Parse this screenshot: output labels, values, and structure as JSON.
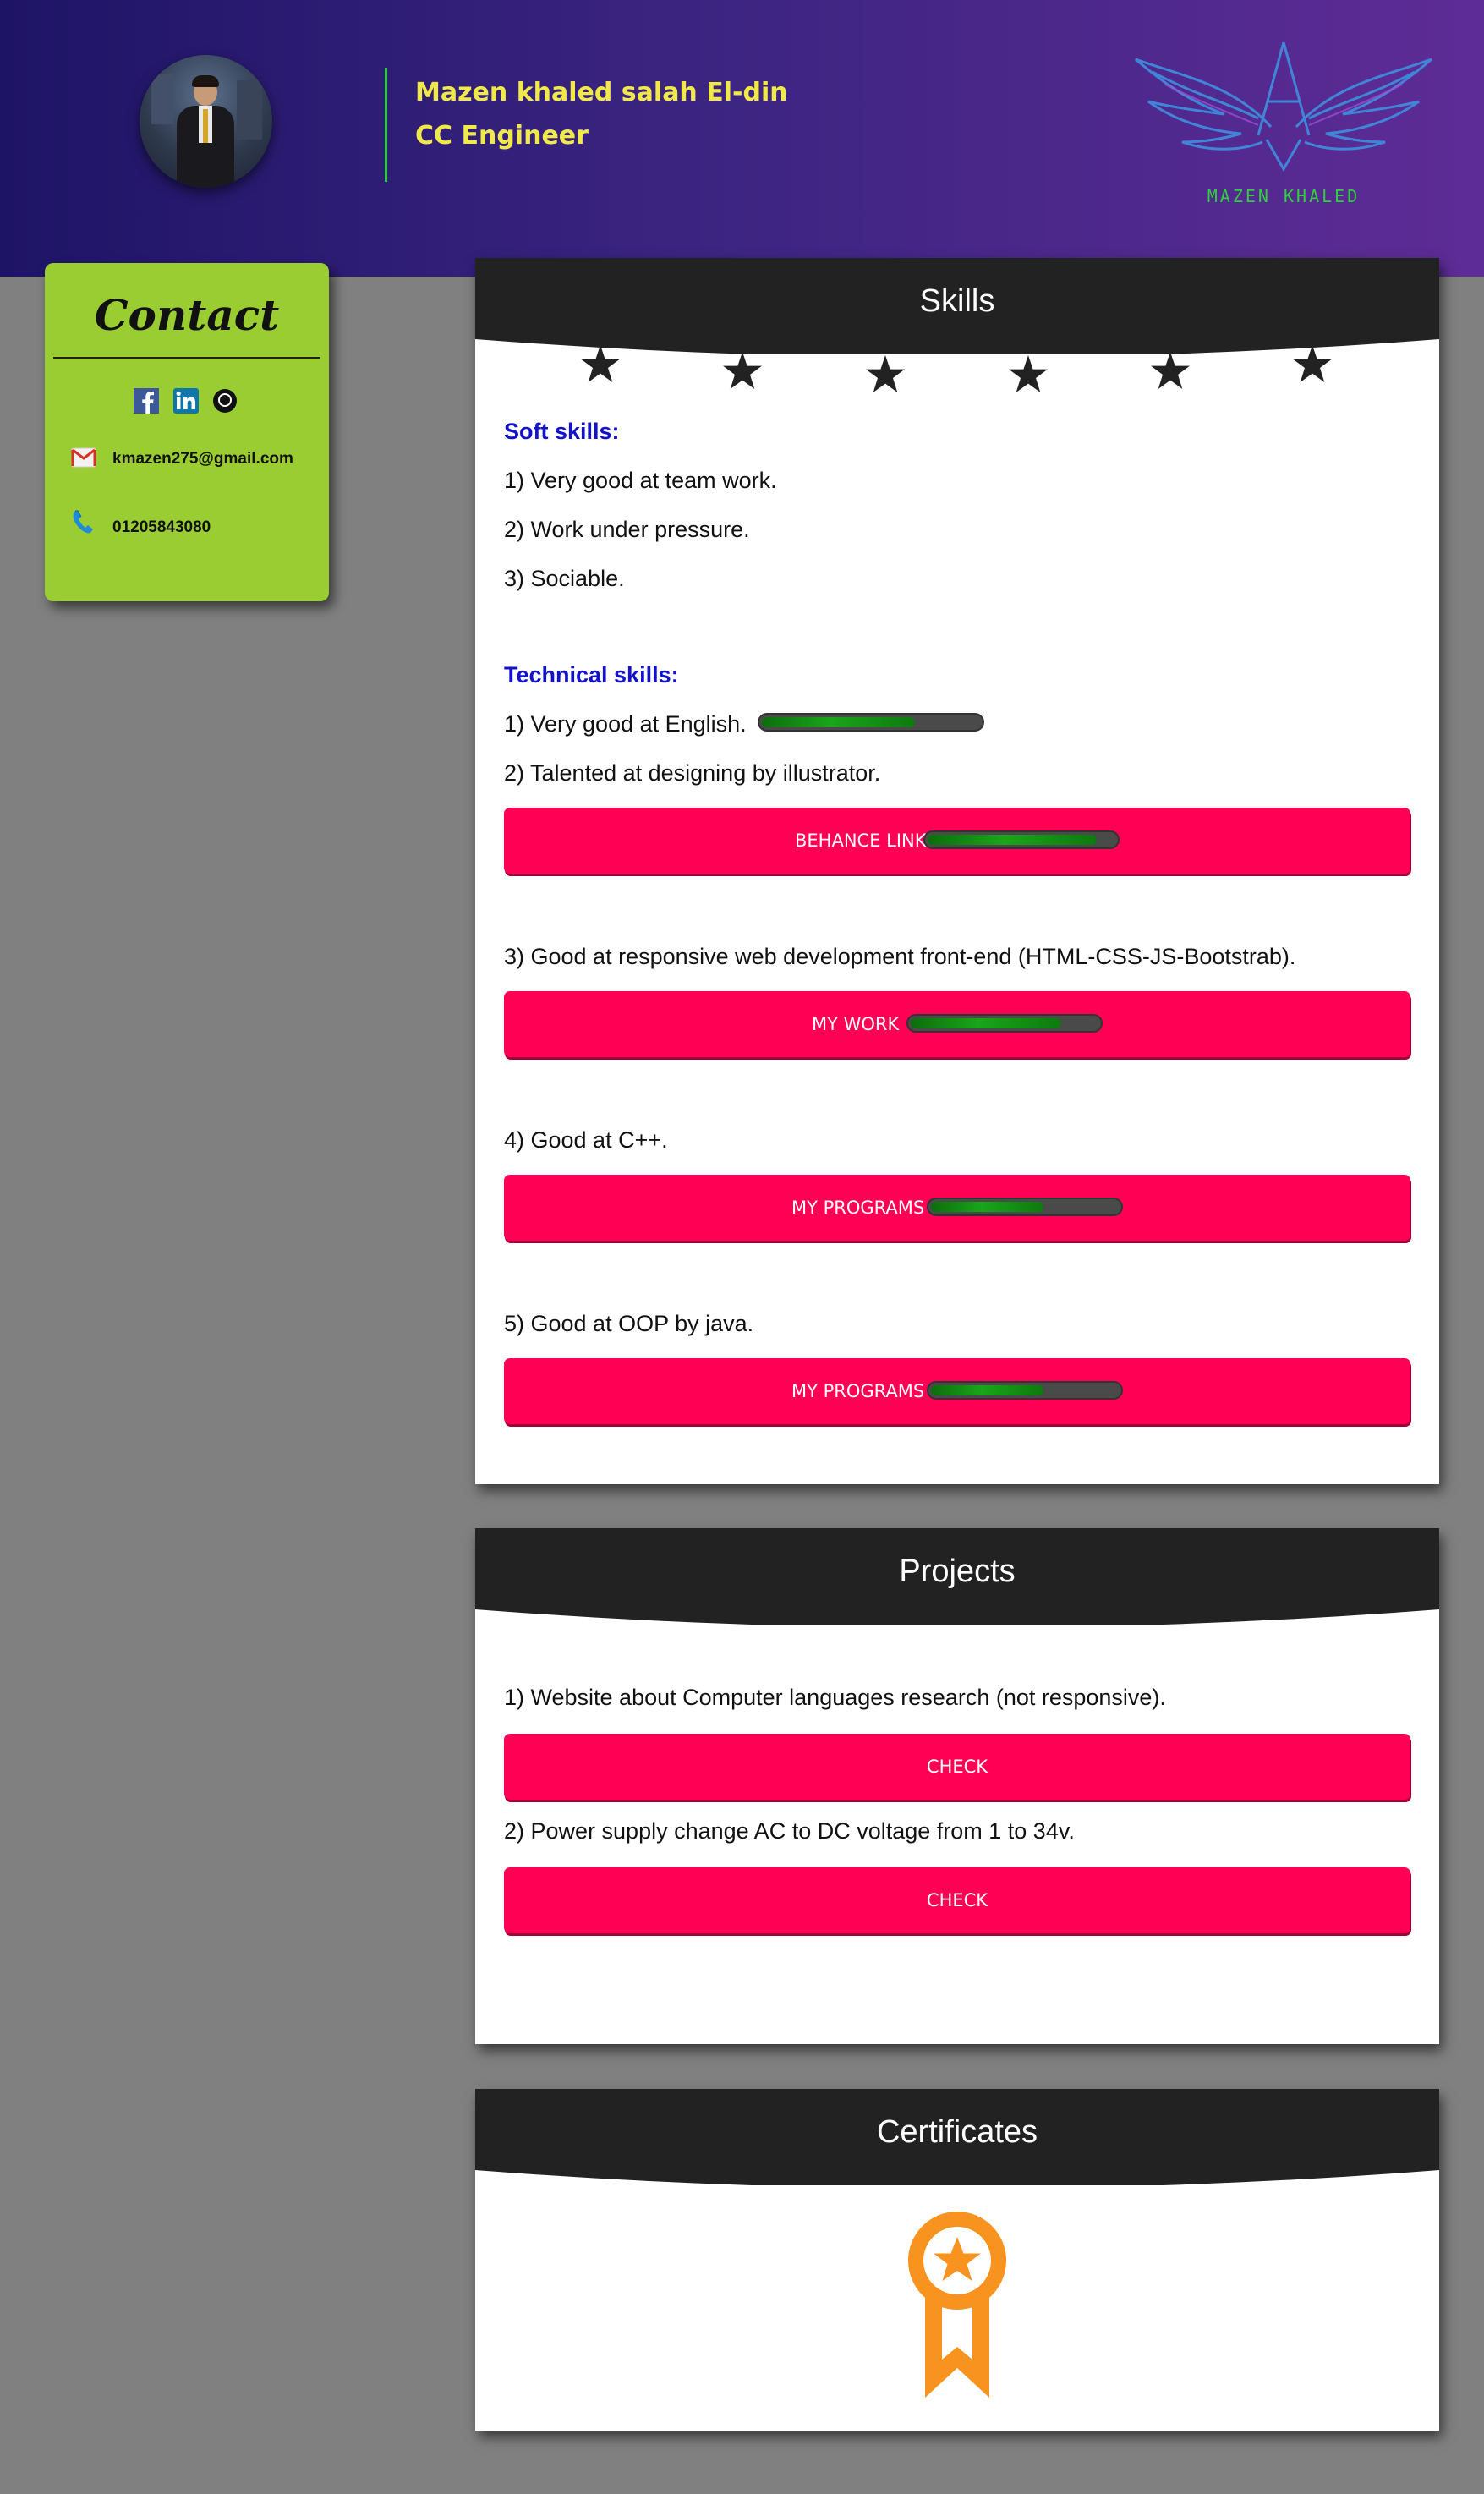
{
  "header": {
    "name": "Mazen khaled salah El-din",
    "role": "CC Engineer",
    "logo_text": "MAZEN KHALED",
    "accent_color": "#f1e94a",
    "divider_color": "#27d32e"
  },
  "contact": {
    "title": "Contact",
    "social_icons": [
      "facebook-icon",
      "linkedin-icon",
      "github-icon"
    ],
    "email": "kmazen275@gmail.com",
    "phone": "01205843080",
    "background": "#9acd32"
  },
  "skills": {
    "title": "Skills",
    "soft_heading": "Soft skills:",
    "soft": [
      "1) Very good at team work.",
      "2) Work under pressure.",
      "3) Sociable."
    ],
    "tech_heading": "Technical skills:",
    "tech": [
      {
        "text": "1) Very good at English.",
        "level": 0.7
      },
      {
        "text": "2) Talented at designing by illustrator.",
        "button": "BEHANCE LINK",
        "level": 0.9
      },
      {
        "text": "3) Good at responsive web development front-end (HTML-CSS-JS-Bootstrab).",
        "button": "MY WORK",
        "level": 0.8
      },
      {
        "text": "4) Good at C++.",
        "button": "MY PROGRAMS",
        "level": 0.6
      },
      {
        "text": "5) Good at OOP by java.",
        "button": "MY PROGRAMS",
        "level": 0.6
      }
    ]
  },
  "projects": {
    "title": "Projects",
    "items": [
      {
        "text": "1) Website about Computer languages research (not responsive).",
        "button": "CHECK"
      },
      {
        "text": "2) Power supply change AC to DC voltage from 1 to 34v.",
        "button": "CHECK"
      }
    ]
  },
  "certificates": {
    "title": "Certificates",
    "icon": "medal-icon"
  },
  "colors": {
    "button": "#ff0055",
    "card_header": "#222222",
    "heading_blue": "#1212cc",
    "progress_fill": "#1aa51a"
  }
}
